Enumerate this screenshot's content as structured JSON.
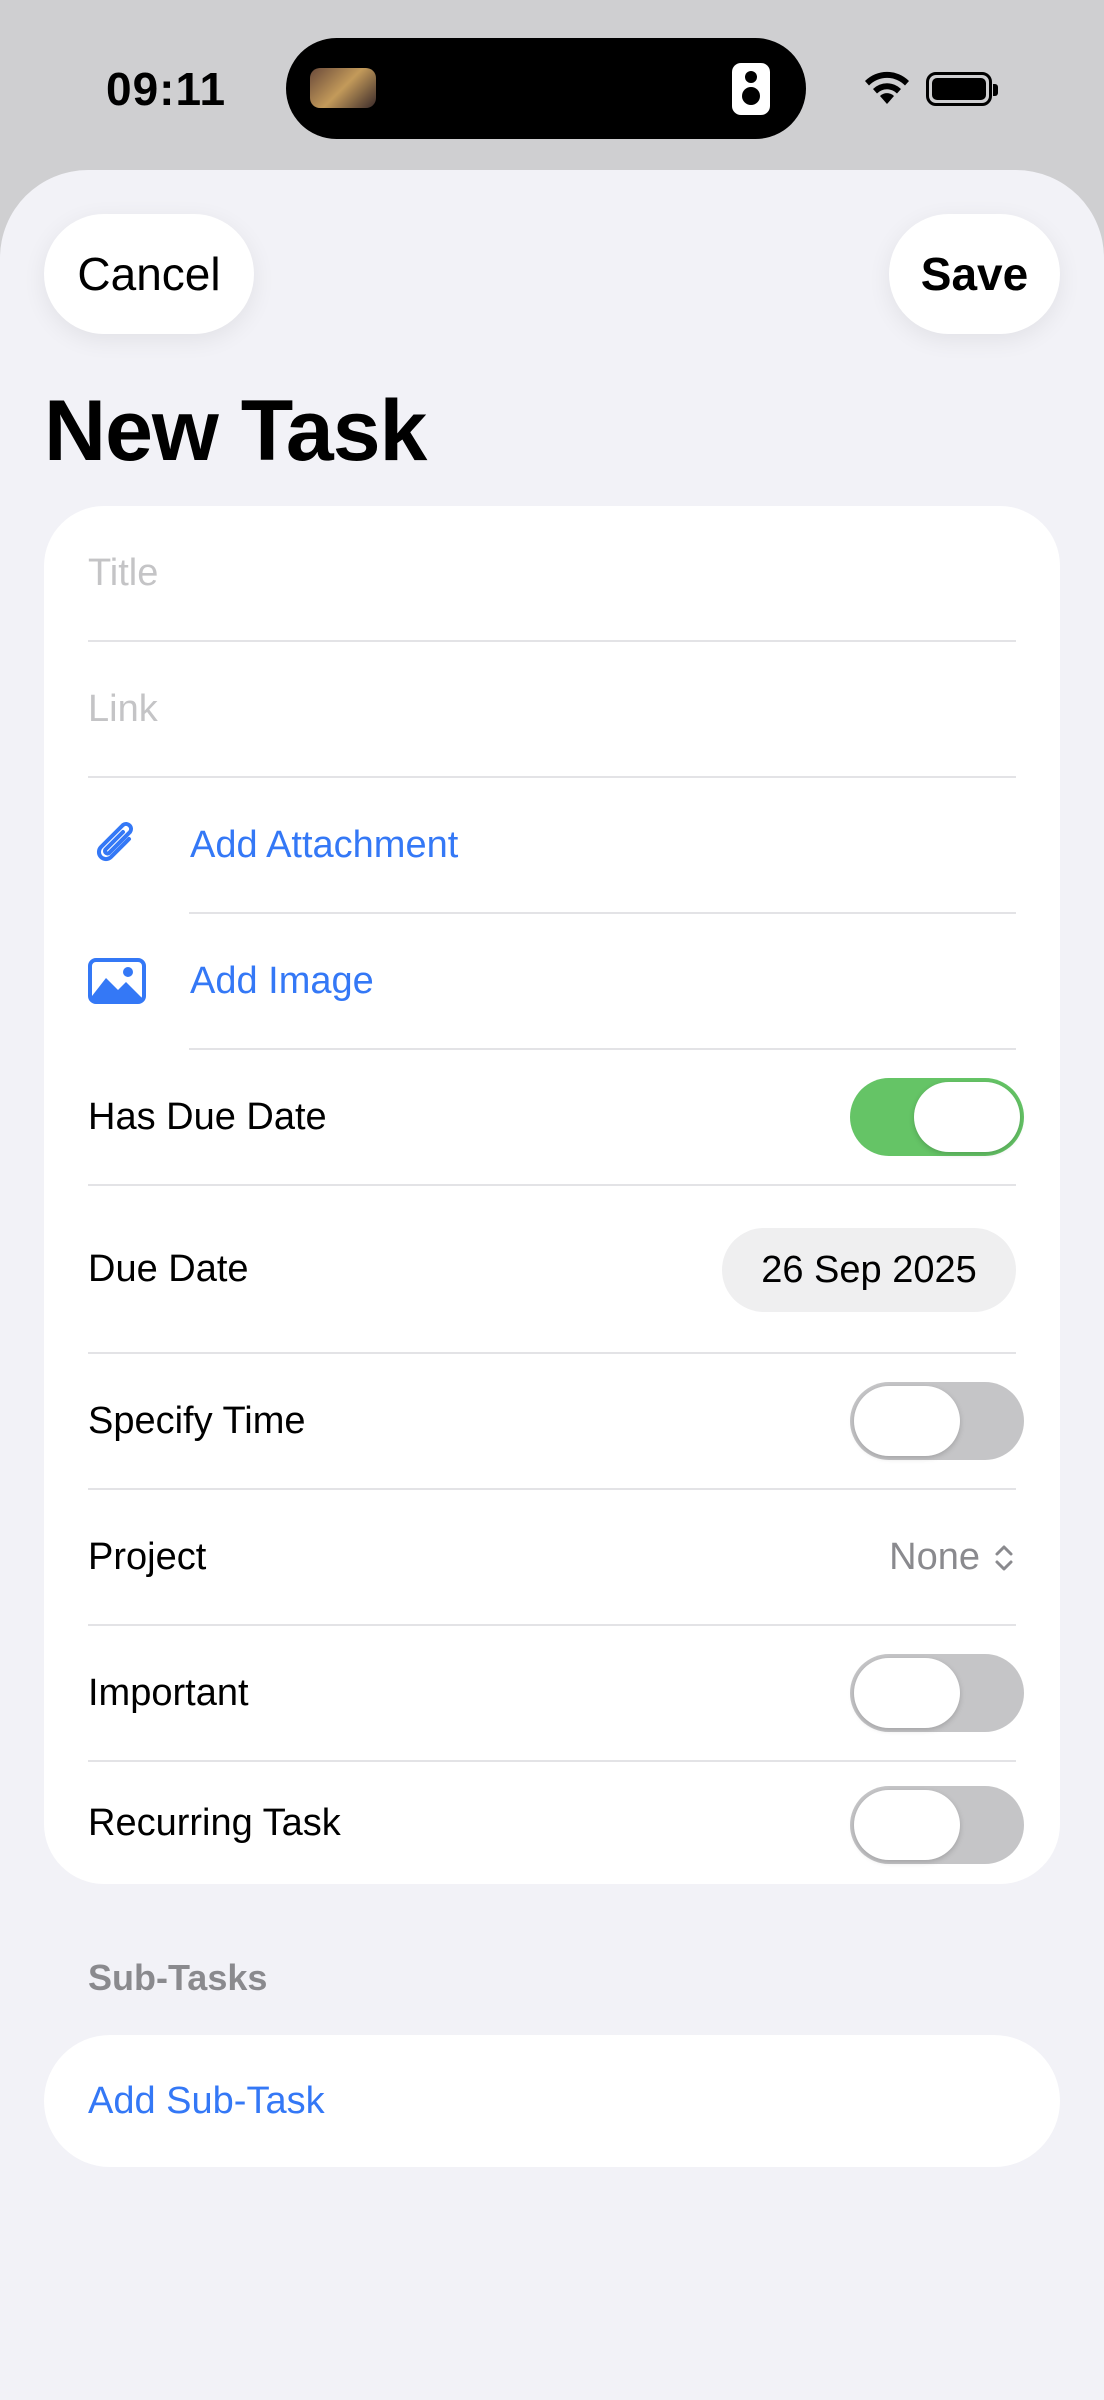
{
  "status_bar": {
    "time": "09:11",
    "icons": [
      "wifi-icon",
      "battery-icon"
    ]
  },
  "nav": {
    "cancel_label": "Cancel",
    "save_label": "Save"
  },
  "page_title": "New Task",
  "form": {
    "title_placeholder": "Title",
    "link_placeholder": "Link",
    "attachment_label": "Add Attachment",
    "image_label": "Add Image",
    "has_due_date_label": "Has Due Date",
    "has_due_date_on": true,
    "due_date_label": "Due Date",
    "due_date_value": "26 Sep 2025",
    "specify_time_label": "Specify Time",
    "specify_time_on": false,
    "project_label": "Project",
    "project_value": "None",
    "important_label": "Important",
    "important_on": false,
    "recurring_label": "Recurring Task",
    "recurring_on": false
  },
  "subtasks": {
    "header": "Sub-Tasks",
    "add_label": "Add Sub-Task"
  },
  "colors": {
    "accent": "#3478f6",
    "toggle_on": "#65c466",
    "toggle_off": "#c5c5c7",
    "sheet_background": "#f2f2f7"
  }
}
